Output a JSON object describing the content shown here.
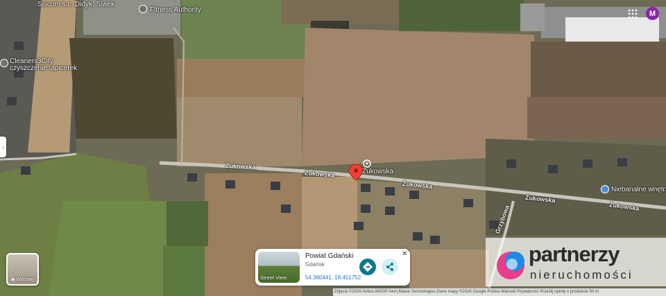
{
  "map": {
    "type": "satellite",
    "pin_color": "#ea4335",
    "poi_labels": [
      "Siscom s.c. Didyk, Siwek",
      "Fitness Authority",
      "Cleaners3City",
      "czyszczenie tapicerek",
      "Żukowska",
      "Niebanalne wnętrza"
    ],
    "road_labels": {
      "zukowska_1": "Żukowska",
      "zukowska_2": "Żukowska",
      "zukowska_3": "Żukowska",
      "zukowska_4": "Żukowska",
      "zukowska_5": "Żukowska",
      "grzybowa": "Grzybowa"
    }
  },
  "account": {
    "avatar_letter": "M",
    "avatar_color": "#8e24aa"
  },
  "layers_button": {
    "label": "Warstwy"
  },
  "place_card": {
    "title": "Powiat Gdański",
    "subtitle": "Gdańsk",
    "coordinates": "54.360441, 18.451752",
    "street_view_label": "Street View",
    "close_label": "✕"
  },
  "attribution": {
    "text": "Zdjęcia ©2026 Airbus,MGGP Aero,Maxar Technologies,Dane mapy ©2026 Google   Polska   Warunki   Prywatność   Prześlij opinię o produkcie   50 m"
  },
  "watermark": {
    "line1": "partnerzy",
    "line2": "nieruchomości"
  }
}
